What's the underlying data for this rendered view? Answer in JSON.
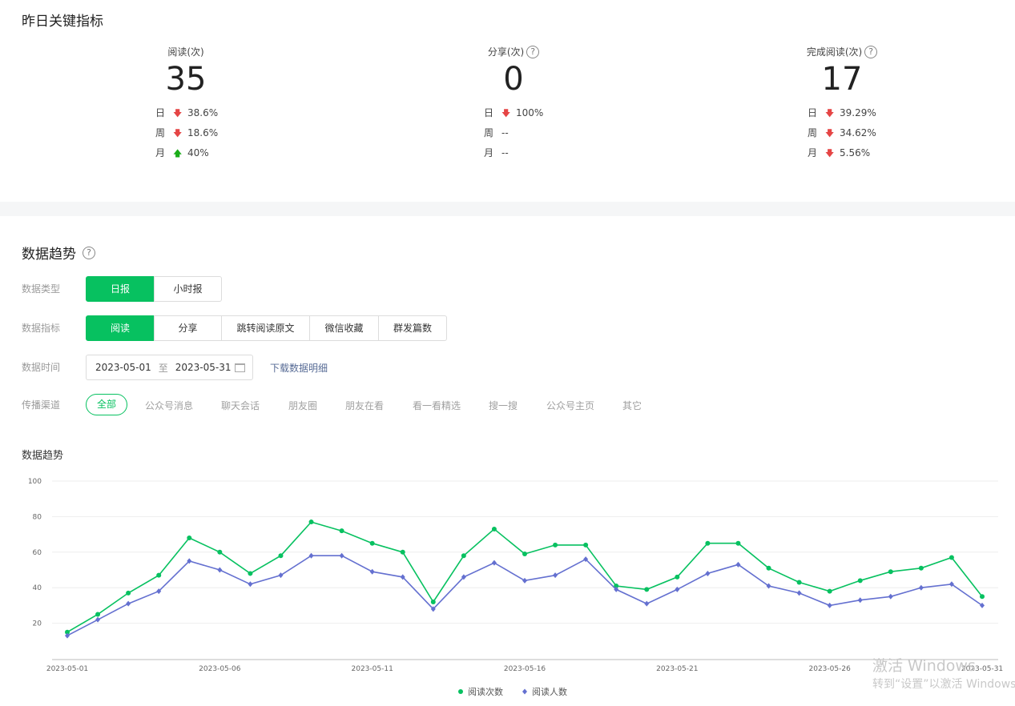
{
  "section1": {
    "title": "昨日关键指标",
    "metrics": [
      {
        "label": "阅读(次)",
        "has_help": false,
        "value": "35",
        "rows": [
          {
            "label": "日",
            "dir": "down",
            "value": "38.6%"
          },
          {
            "label": "周",
            "dir": "down",
            "value": "18.6%"
          },
          {
            "label": "月",
            "dir": "up",
            "value": "40%"
          }
        ]
      },
      {
        "label": "分享(次)",
        "has_help": true,
        "value": "0",
        "rows": [
          {
            "label": "日",
            "dir": "down",
            "value": "100%"
          },
          {
            "label": "周",
            "dir": "none",
            "value": "--"
          },
          {
            "label": "月",
            "dir": "none",
            "value": "--"
          }
        ]
      },
      {
        "label": "完成阅读(次)",
        "has_help": true,
        "value": "17",
        "rows": [
          {
            "label": "日",
            "dir": "down",
            "value": "39.29%"
          },
          {
            "label": "周",
            "dir": "down",
            "value": "34.62%"
          },
          {
            "label": "月",
            "dir": "down",
            "value": "5.56%"
          }
        ]
      }
    ]
  },
  "section2": {
    "title": "数据趋势",
    "help_icon": "?",
    "type_label": "数据类型",
    "type_options": [
      "日报",
      "小时报"
    ],
    "type_selected": "日报",
    "metric_label": "数据指标",
    "metric_options": [
      "阅读",
      "分享",
      "跳转阅读原文",
      "微信收藏",
      "群发篇数"
    ],
    "metric_selected": "阅读",
    "time_label": "数据时间",
    "date_start": "2023-05-01",
    "date_sep": "至",
    "date_end": "2023-05-31",
    "download_link": "下载数据明细",
    "channel_label": "传播渠道",
    "channels": [
      "全部",
      "公众号消息",
      "聊天会话",
      "朋友圈",
      "朋友在看",
      "看一看精选",
      "搜一搜",
      "公众号主页",
      "其它"
    ],
    "channel_selected": "全部",
    "chart_title": "数据趋势"
  },
  "chart_data": {
    "type": "line",
    "ylim": [
      0,
      100
    ],
    "yticks": [
      20,
      40,
      60,
      80,
      100
    ],
    "x": [
      "2023-05-01",
      "2023-05-02",
      "2023-05-03",
      "2023-05-04",
      "2023-05-05",
      "2023-05-06",
      "2023-05-07",
      "2023-05-08",
      "2023-05-09",
      "2023-05-10",
      "2023-05-11",
      "2023-05-12",
      "2023-05-13",
      "2023-05-14",
      "2023-05-15",
      "2023-05-16",
      "2023-05-17",
      "2023-05-18",
      "2023-05-19",
      "2023-05-20",
      "2023-05-21",
      "2023-05-22",
      "2023-05-23",
      "2023-05-24",
      "2023-05-25",
      "2023-05-26",
      "2023-05-27",
      "2023-05-28",
      "2023-05-29",
      "2023-05-30",
      "2023-05-31"
    ],
    "xtick_labels": [
      "2023-05-01",
      "2023-05-06",
      "2023-05-11",
      "2023-05-16",
      "2023-05-21",
      "2023-05-26",
      "2023-05-31"
    ],
    "series": [
      {
        "name": "阅读次数",
        "color": "#07c160",
        "marker": "circle",
        "values": [
          15,
          25,
          37,
          47,
          68,
          60,
          48,
          58,
          77,
          72,
          65,
          60,
          32,
          58,
          73,
          59,
          64,
          64,
          41,
          39,
          46,
          65,
          65,
          51,
          43,
          38,
          44,
          49,
          51,
          57,
          35
        ]
      },
      {
        "name": "阅读人数",
        "color": "#6470d0",
        "marker": "diamond",
        "values": [
          13,
          22,
          31,
          38,
          55,
          50,
          42,
          47,
          58,
          58,
          49,
          46,
          28,
          46,
          54,
          44,
          47,
          56,
          39,
          31,
          39,
          48,
          53,
          41,
          37,
          30,
          33,
          35,
          40,
          42,
          30
        ]
      }
    ],
    "grid": true,
    "legend": "bottom-center"
  },
  "watermark": {
    "line1": "激活 Windows",
    "line2": "转到“设置”以激活 Windows。"
  }
}
